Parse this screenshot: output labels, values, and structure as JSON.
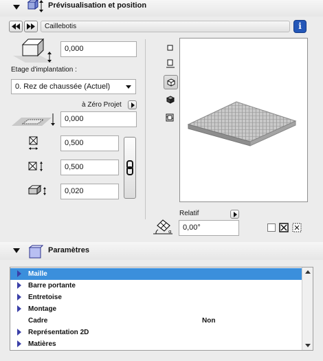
{
  "preview_section": {
    "title": "Prévisualisation et position"
  },
  "object_name": "Caillebotis",
  "height_value": "0,000",
  "storey": {
    "label": "Etage d'implantation :",
    "selected": "0. Rez de chaussée (Actuel)"
  },
  "zero_project": {
    "label": "à Zéro Projet",
    "value": "0,000"
  },
  "dim_x": "0,500",
  "dim_y": "0,500",
  "dim_z": "0,020",
  "rotation": {
    "label": "Relatif",
    "value": "0,00°"
  },
  "params_section": {
    "title": "Paramètres",
    "rows": [
      {
        "label": "Maille",
        "value": "",
        "expandable": true,
        "selected": true
      },
      {
        "label": "Barre portante",
        "value": "",
        "expandable": true,
        "selected": false
      },
      {
        "label": "Entretoise",
        "value": "",
        "expandable": true,
        "selected": false
      },
      {
        "label": "Montage",
        "value": "",
        "expandable": true,
        "selected": false
      },
      {
        "label": "Cadre",
        "value": "Non",
        "expandable": false,
        "selected": false
      },
      {
        "label": "Représentation 2D",
        "value": "",
        "expandable": true,
        "selected": false
      },
      {
        "label": "Matières",
        "value": "",
        "expandable": true,
        "selected": false
      }
    ]
  },
  "colors": {
    "selection": "#3b8fdc",
    "expand_arrow": "#3a3fa8",
    "info_button": "#2457b8"
  }
}
